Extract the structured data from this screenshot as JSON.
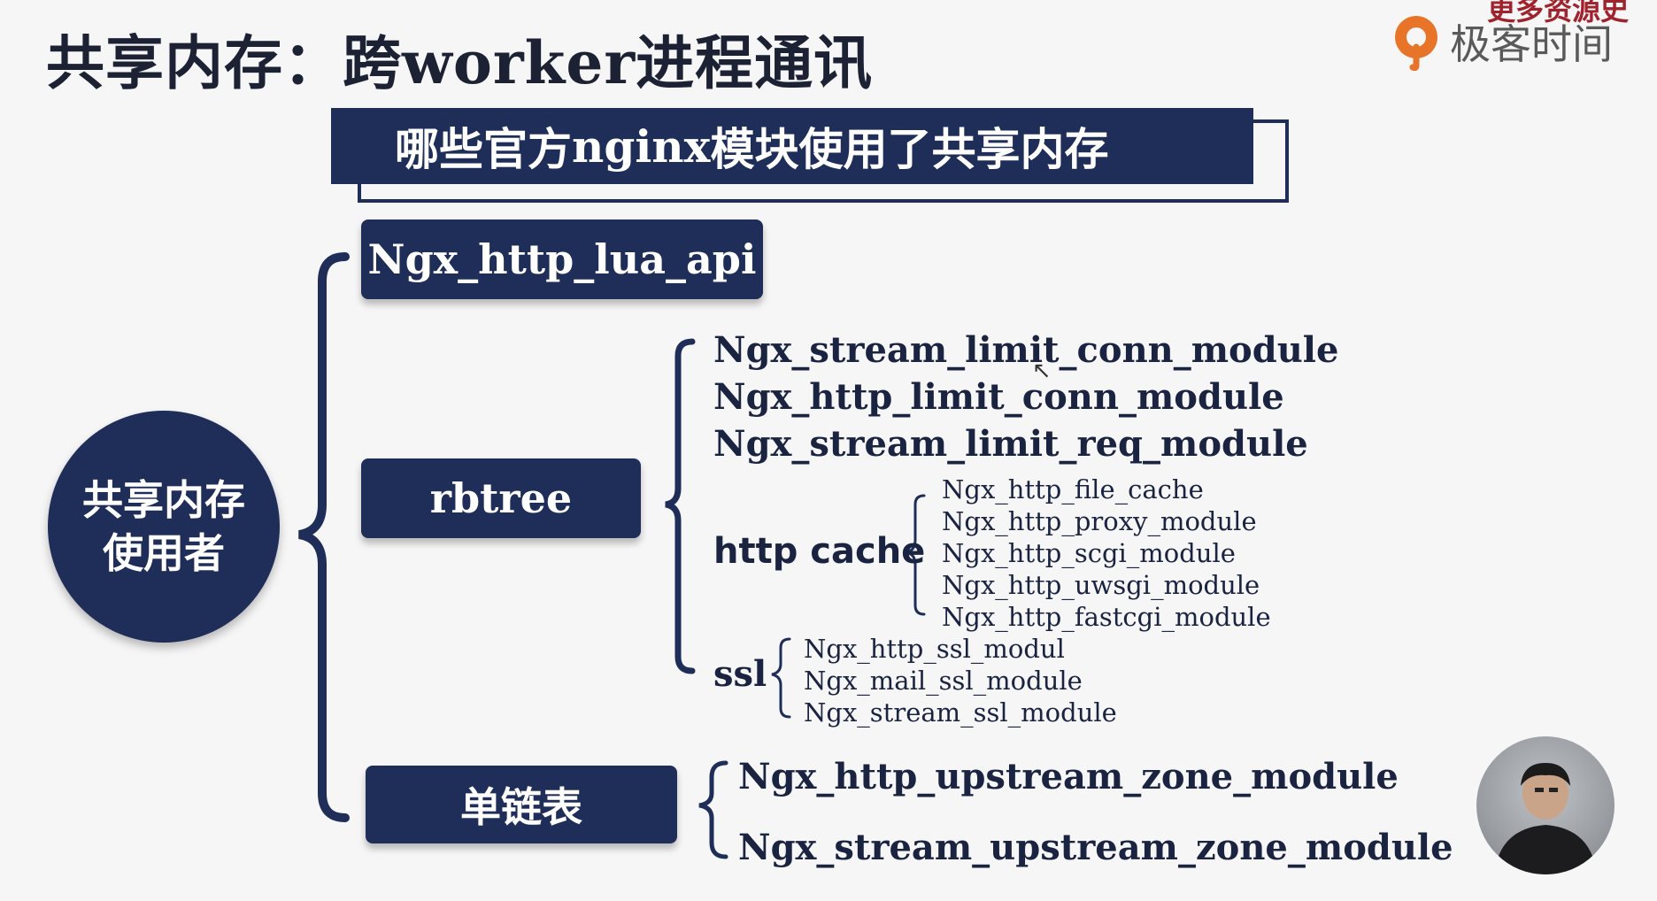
{
  "title": {
    "cn_a": "共享内存：跨",
    "latin": "worker",
    "cn_b": "进程通讯"
  },
  "watermark": "更多资源史",
  "logo": {
    "text": "极客时间",
    "icon": "geektime-logo-icon",
    "accent": "#e8742a"
  },
  "banner": {
    "cn_a": "哪些官方",
    "latin": "nginx",
    "cn_b": "模块使用了共享内存"
  },
  "root": {
    "line1": "共享内存",
    "line2": "使用者"
  },
  "branches": {
    "lua_api": "Ngx_http_lua_api",
    "rbtree": {
      "label": "rbtree",
      "modules": [
        "Ngx_stream_limit_conn_module",
        "Ngx_http_limit_conn_module",
        "Ngx_stream_limit_req_module"
      ],
      "http_cache": {
        "label": "http cache",
        "modules": [
          "Ngx_http_file_cache",
          "Ngx_http_proxy_module",
          "Ngx_http_scgi_module",
          "Ngx_http_uwsgi_module",
          "Ngx_http_fastcgi_module"
        ]
      },
      "ssl": {
        "label": "ssl",
        "modules": [
          "Ngx_http_ssl_modul",
          "Ngx_mail_ssl_module",
          "Ngx_stream_ssl_module"
        ]
      }
    },
    "linked_list": {
      "label": "单链表",
      "modules": [
        "Ngx_http_upstream_zone_module",
        "Ngx_stream_upstream_zone_module"
      ]
    }
  },
  "colors": {
    "navy": "#1f2d59",
    "text": "#1a2340",
    "background": "#f6f6f7"
  }
}
